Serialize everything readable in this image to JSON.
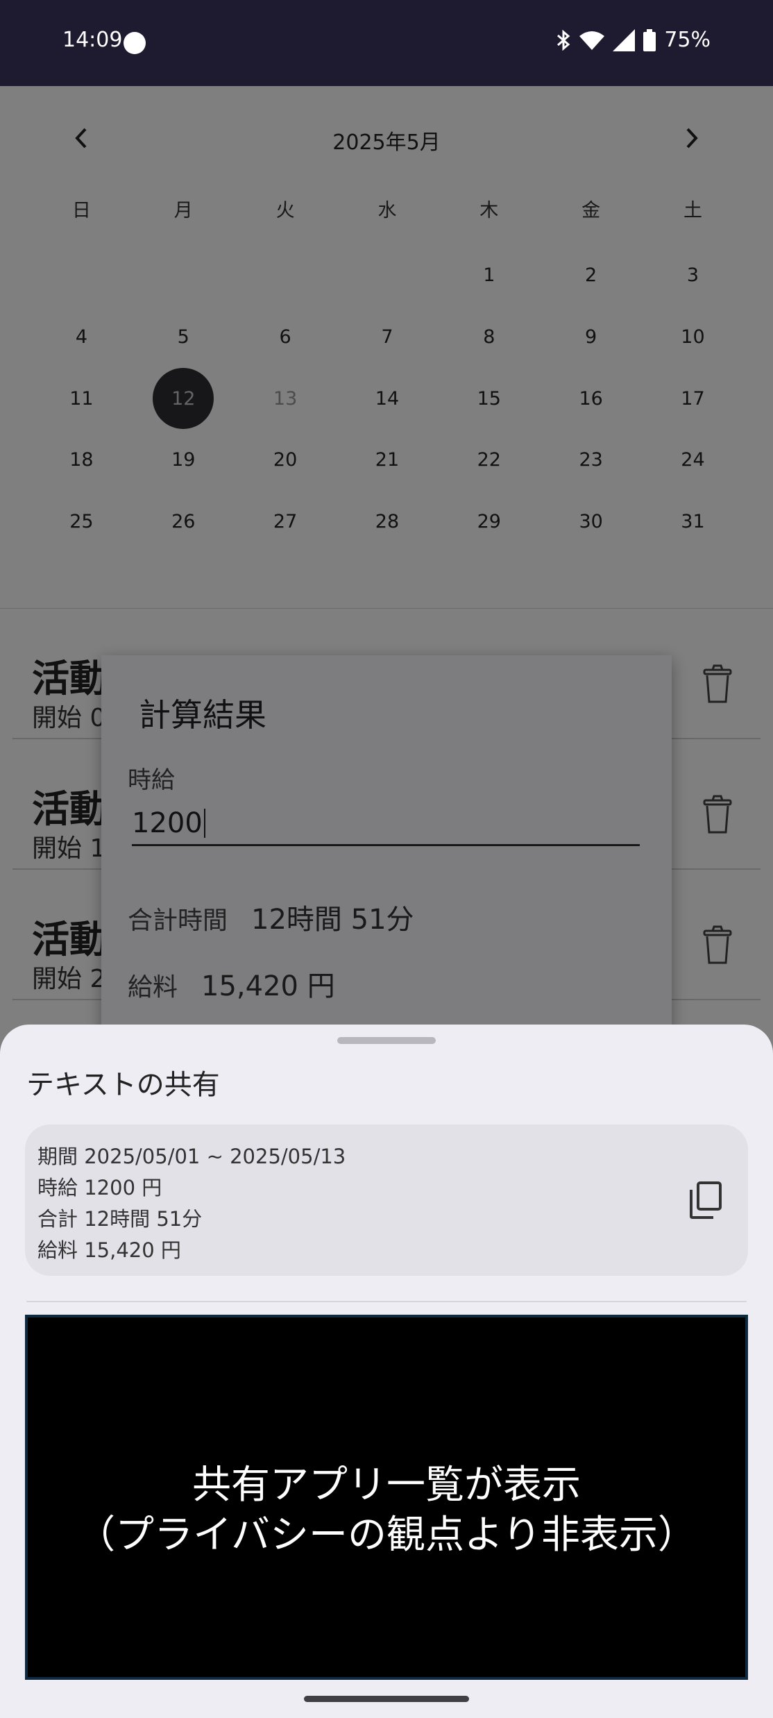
{
  "status_bar": {
    "time": "14:09",
    "battery": "75%"
  },
  "calendar": {
    "title": "2025年5月",
    "weekdays": [
      "日",
      "月",
      "火",
      "水",
      "木",
      "金",
      "土"
    ],
    "weeks": [
      [
        "",
        "",
        "",
        "",
        "1",
        "2",
        "3"
      ],
      [
        "4",
        "5",
        "6",
        "7",
        "8",
        "9",
        "10"
      ],
      [
        "11",
        "12",
        "13",
        "14",
        "15",
        "16",
        "17"
      ],
      [
        "18",
        "19",
        "20",
        "21",
        "22",
        "23",
        "24"
      ],
      [
        "25",
        "26",
        "27",
        "28",
        "29",
        "30",
        "31"
      ]
    ],
    "selected_day": "12",
    "muted_day": "13"
  },
  "activities": [
    {
      "title": "活動時間",
      "subtitle": "開始 0"
    },
    {
      "title": "活動",
      "subtitle": "開始 1"
    },
    {
      "title": "活動",
      "subtitle": "開始 2"
    }
  ],
  "dialog": {
    "title": "計算結果",
    "wage_label": "時給",
    "wage_value": "1200",
    "total_label": "合計時間",
    "total_value": "12時間 51分",
    "salary_label": "給料",
    "salary_value": "15,420 円"
  },
  "share_sheet": {
    "title": "テキストの共有",
    "preview_lines": [
      "期間 2025/05/01 ~ 2025/05/13",
      "時給 1200 円",
      "合計 12時間 51分",
      "給料 15,420 円"
    ],
    "apps_placeholder_line1": "共有アプリ一覧が表示",
    "apps_placeholder_line2": "（プライバシーの観点より非表示）"
  }
}
